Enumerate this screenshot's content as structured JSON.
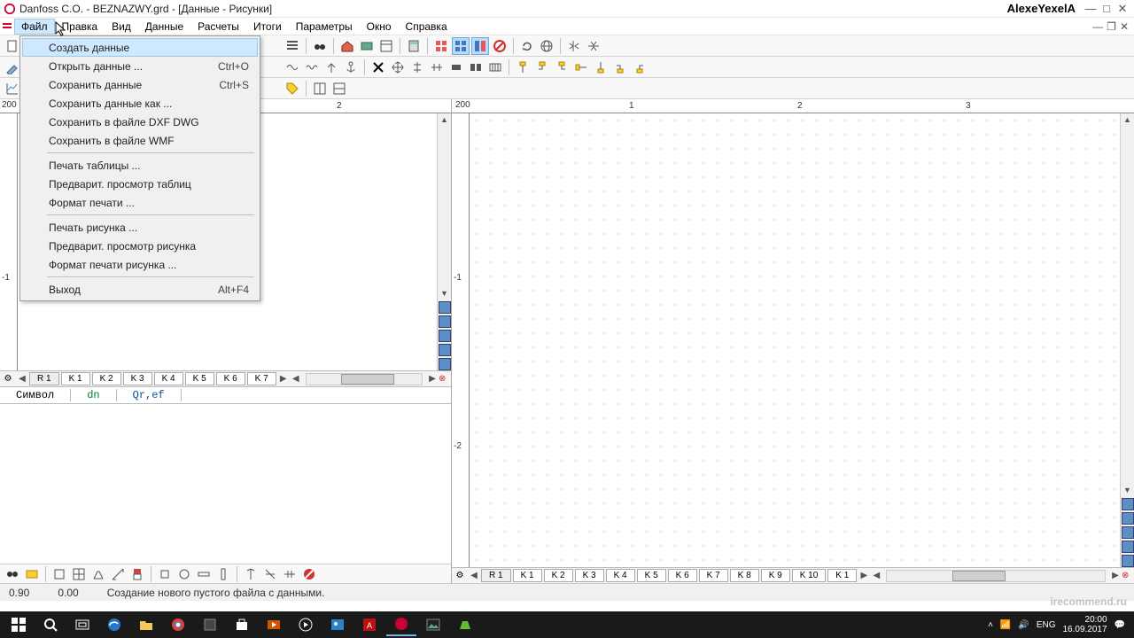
{
  "title": "Danfoss C.O.  - BEZNAZWY.grd - [Данные - Рисунки]",
  "user": "AlexeYexelA",
  "menu": {
    "items": [
      "Файл",
      "Правка",
      "Вид",
      "Данные",
      "Расчеты",
      "Итоги",
      "Параметры",
      "Окно",
      "Справка"
    ]
  },
  "file_menu": {
    "items": [
      {
        "label": "Создать данные",
        "hl": true
      },
      {
        "label": "Открыть данные ...",
        "sc": "Ctrl+O"
      },
      {
        "label": "Сохранить данные",
        "sc": "Ctrl+S"
      },
      {
        "label": "Сохранить данные как ..."
      },
      {
        "label": "Сохранить в файле DXF DWG"
      },
      {
        "label": "Сохранить в файле WMF"
      }
    ],
    "group2": [
      {
        "label": "Печать таблицы ..."
      },
      {
        "label": "Предварит. просмотр таблиц"
      },
      {
        "label": "Формат печати ..."
      }
    ],
    "group3": [
      {
        "label": "Печать рисунка ..."
      },
      {
        "label": "Предварит. просмотр рисунка"
      },
      {
        "label": "Формат печати рисунка ..."
      }
    ],
    "exit": {
      "label": "Выход",
      "sc": "Alt+F4"
    }
  },
  "ruler_left": {
    "start": "200",
    "ticks": [
      "2"
    ]
  },
  "ruler_right": {
    "start": "200",
    "ticks": [
      "1",
      "2",
      "3"
    ]
  },
  "vruler": {
    "ticks": [
      "-1",
      "-1",
      "-2"
    ]
  },
  "tabs_left": {
    "first": "R 1",
    "items": [
      "K 1",
      "K 2",
      "K 3",
      "K 4",
      "K 5",
      "K 6",
      "K 7"
    ]
  },
  "tabs_right": {
    "first": "R 1",
    "items": [
      "K 1",
      "K 2",
      "K 3",
      "K 4",
      "K 5",
      "K 6",
      "K 7",
      "K 8",
      "K 9",
      "K 10",
      "K 1"
    ]
  },
  "prop": {
    "symbol": "Символ",
    "dn": "dn",
    "qref": "Qr,ef"
  },
  "status": {
    "v1": "0.90",
    "v2": "0.00",
    "hint": "Создание нового пустого файла с данными."
  },
  "clock": {
    "time": "20:00",
    "date": "16.09.2017"
  },
  "watermark": "irecommend.ru"
}
